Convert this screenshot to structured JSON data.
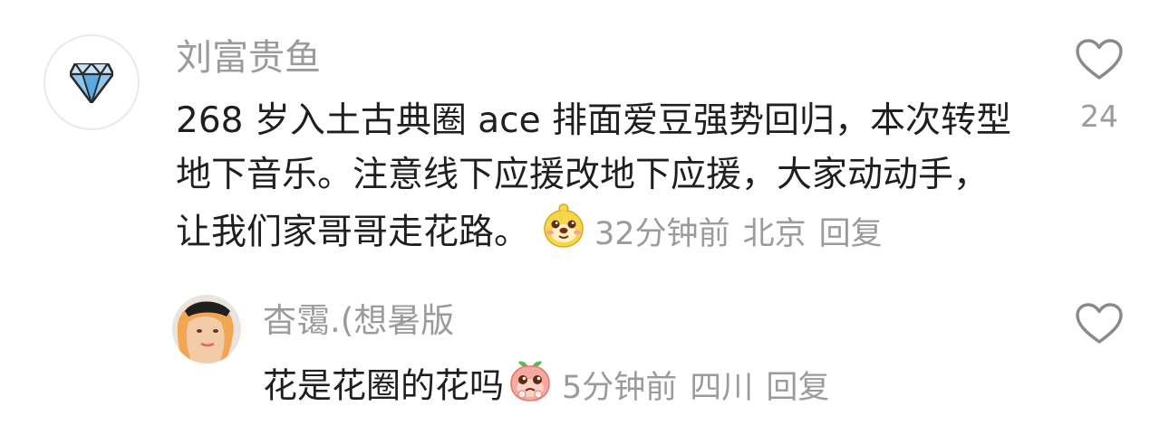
{
  "main_comment": {
    "username": "刘富贵鱼",
    "text": "268 岁入土古典圈 ace 排面爱豆强势回归，本次转型地下音乐。注意线下应援改地下应援，大家动动手，让我们家哥哥走花路。",
    "emoji": "dog-face-emoji",
    "time": "32分钟前",
    "location": "北京",
    "reply_label": "回复",
    "like_count": "24"
  },
  "reply_comment": {
    "username": "杳霭.(想暑版",
    "text": "花是花圈的花吗",
    "emoji": "crying-peach-emoji",
    "time": "5分钟前",
    "location": "四川",
    "reply_label": "回复"
  },
  "icons": {
    "avatar_main": "diamond-icon",
    "like": "heart-outline-icon"
  }
}
